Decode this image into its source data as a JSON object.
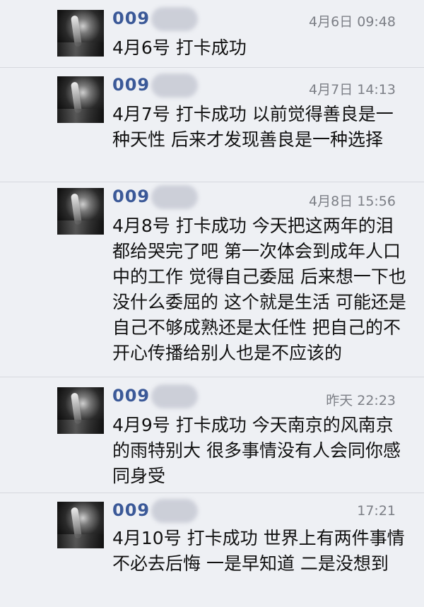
{
  "messages": [
    {
      "sender": "009",
      "time": "4月6日 09:48",
      "text": "4月6号 打卡成功"
    },
    {
      "sender": "009",
      "time": "4月7日 14:13",
      "text": "4月7号 打卡成功 以前觉得善良是一种天性 后来才发现善良是一种选择"
    },
    {
      "sender": "009",
      "time": "4月8日 15:56",
      "text": "4月8号 打卡成功 今天把这两年的泪都给哭完了吧 第一次体会到成年人口中的工作 觉得自己委屈 后来想一下也没什么委屈的 这个就是生活 可能还是自己不够成熟还是太任性 把自己的不开心传播给别人也是不应该的"
    },
    {
      "sender": "009",
      "time": "昨天 22:23",
      "text": "4月9号 打卡成功 今天南京的风南京的雨特别大 很多事情没有人会同你感同身受"
    },
    {
      "sender": "009",
      "time": "17:21",
      "text": "4月10号 打卡成功 世界上有两件事情不必去后悔 一是早知道 二是没想到"
    }
  ]
}
